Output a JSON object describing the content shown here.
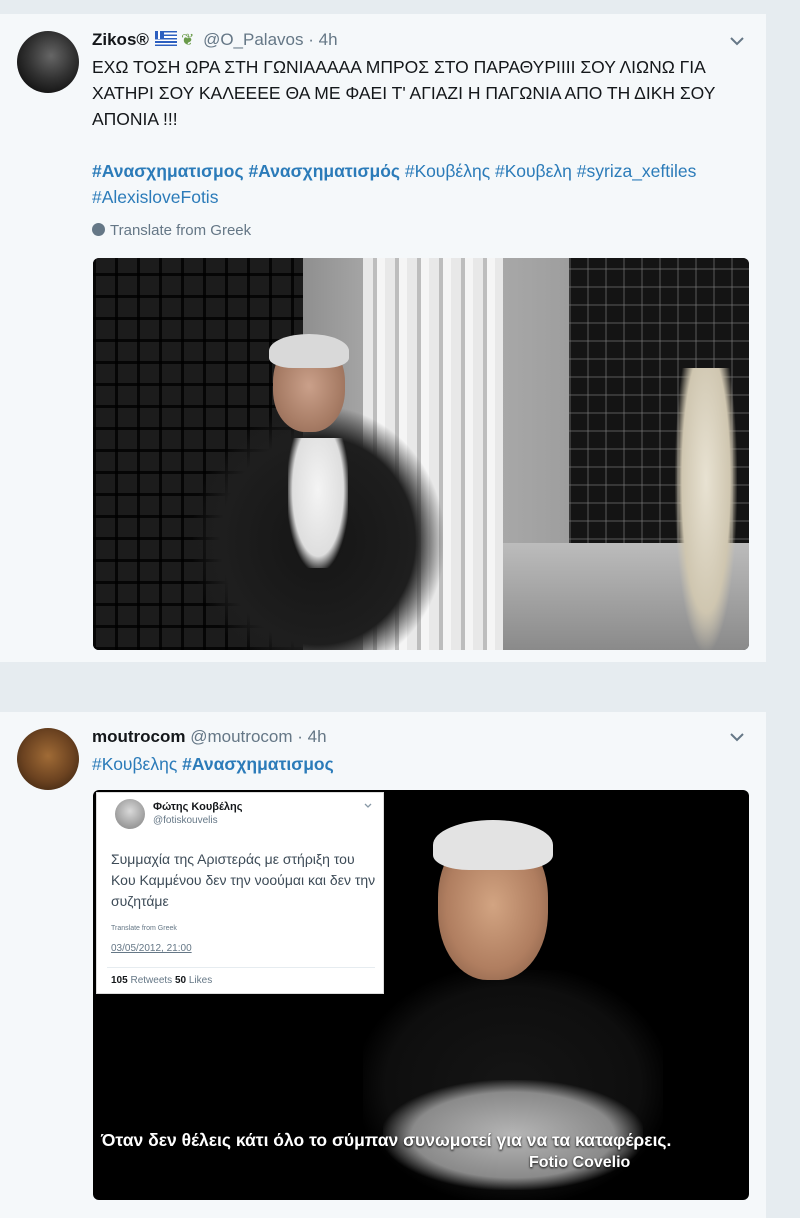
{
  "tweet1": {
    "name": "Zikos®",
    "handle": "@O_Palavos",
    "separator": "·",
    "time": "4h",
    "text": "ΕΧΩ ΤΟΣΗ ΩΡΑ ΣΤΗ ΓΩΝΙΑΑΑΑΑ ΜΠΡΟΣ ΣΤΟ ΠΑΡΑΘΥΡΙΙΙΙ ΣΟΥ ΛΙΩΝΩ ΓΙΑ ΧΑΤΗΡΙ ΣΟΥ ΚΑΛΕΕΕΕ ΘΑ ΜΕ ΦΑΕΙ Τ' ΑΓΙΑΖΙ Η ΠΑΓΩΝΙΑ ΑΠΟ ΤΗ ΔΙΚΗ ΣΟΥ ΑΠΟΝΙΑ !!!",
    "hashtags": [
      "#Ανασχηματισμος",
      "#Ανασχηματισμός",
      "#Κουβέλης",
      "#Κουβελη",
      "#syriza_xeftiles",
      "#AlexisloveFotis"
    ],
    "translate_label": "Translate from Greek"
  },
  "tweet2": {
    "name": "moutrocom",
    "handle": "@moutrocom",
    "separator": "·",
    "time": "4h",
    "hashtags": [
      "#Κουβελης",
      "#Ανασχηματισμος"
    ],
    "embedded_card": {
      "name": "Φώτης Κουβέλης",
      "handle": "@fotiskouvelis",
      "text": "Συμμαχία της Αριστεράς με στήριξη του Κου Καμμένου δεν την νοούμαι και δεν την συζητάμε",
      "translate_label": "Translate from Greek",
      "date": "03/05/2012, 21:00",
      "retweets_count": "105",
      "retweets_label": "Retweets",
      "likes_count": "50",
      "likes_label": "Likes"
    },
    "image_caption": "Όταν δεν θέλεις κάτι όλο το σύμπαν συνωμοτεί για να τα καταφέρεις.",
    "image_signature": "Fotio Covelio"
  },
  "icons": {
    "chevron": "chevron-down-icon",
    "globe": "globe-icon",
    "flag": "greece-flag-icon",
    "leaf": "olive-branch-icon"
  },
  "colors": {
    "background": "#e6ecf0",
    "card": "#f5f8fa",
    "hashtag": "#2b7bb9",
    "muted": "#657786",
    "text": "#14171a"
  }
}
